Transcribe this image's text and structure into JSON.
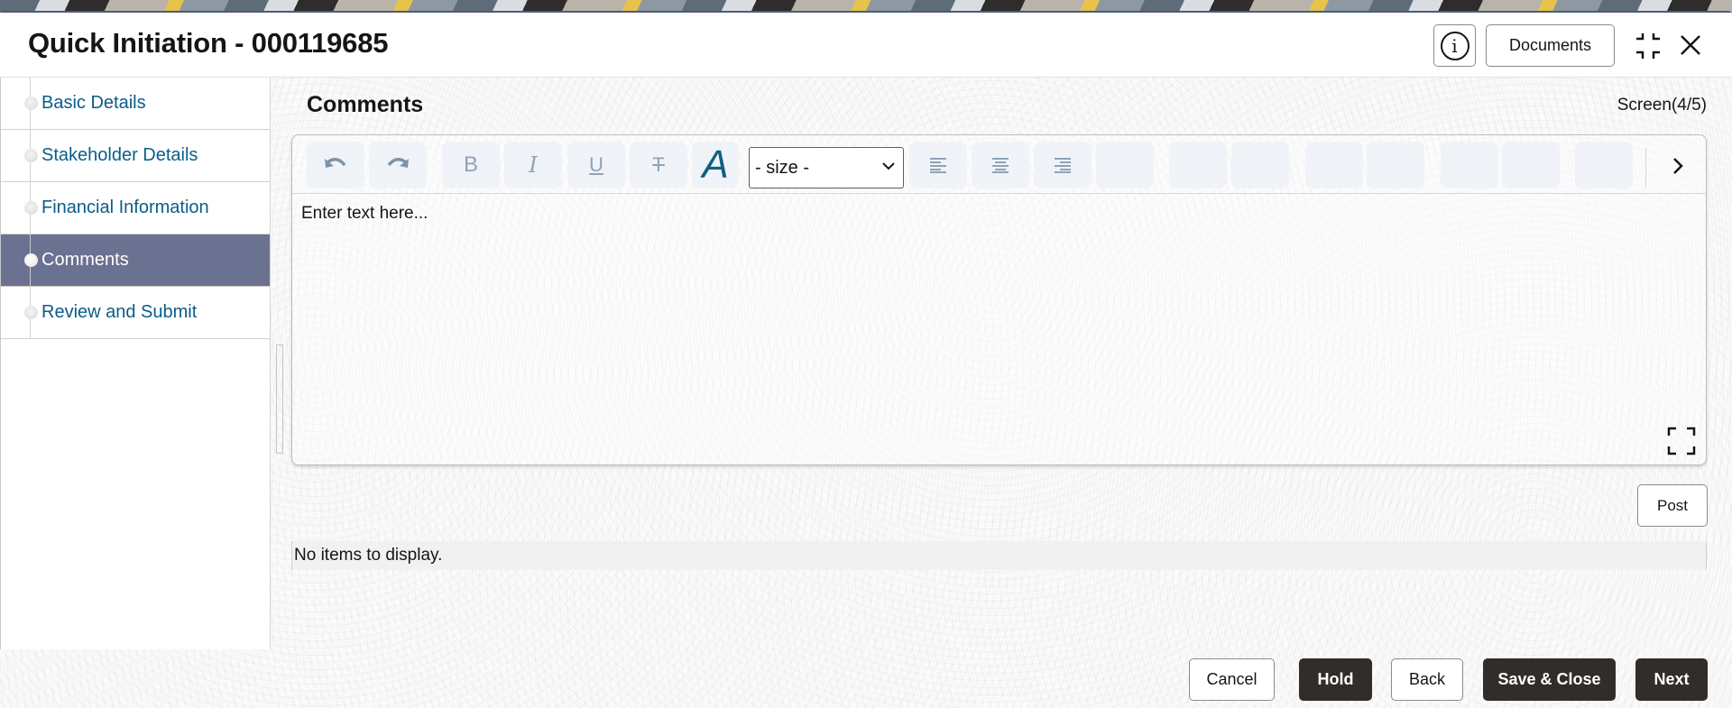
{
  "header": {
    "title": "Quick Initiation - 000119685",
    "info_icon": "info-icon",
    "documents_label": "Documents",
    "minimize_icon": "minimize-icon",
    "close_icon": "close-icon"
  },
  "sidebar": {
    "items": [
      {
        "label": "Basic Details",
        "active": false
      },
      {
        "label": "Stakeholder Details",
        "active": false
      },
      {
        "label": "Financial Information",
        "active": false
      },
      {
        "label": "Comments",
        "active": true
      },
      {
        "label": "Review and Submit",
        "active": false
      }
    ]
  },
  "main": {
    "section_title": "Comments",
    "screen_indicator": "Screen(4/5)",
    "editor": {
      "toolbar": {
        "undo_icon": "undo-icon",
        "redo_icon": "redo-icon",
        "bold_label": "B",
        "italic_label": "I",
        "underline_label": "U",
        "strikethrough_label": "T",
        "font_label": "A",
        "size_select_value": "- size -",
        "align_left_icon": "align-left-icon",
        "align_center_icon": "align-center-icon",
        "align_right_icon": "align-right-icon",
        "more_icon": "chevron-right-icon"
      },
      "placeholder": "Enter text here...",
      "expand_icon": "expand-icon"
    },
    "post_label": "Post",
    "empty_message": "No items to display."
  },
  "footer": {
    "cancel_label": "Cancel",
    "hold_label": "Hold",
    "back_label": "Back",
    "save_close_label": "Save & Close",
    "next_label": "Next"
  },
  "colors": {
    "active_nav": "#6b7291",
    "nav_link": "#0b5c88",
    "primary_button": "#312d2a",
    "font_icon": "#0e6183"
  }
}
